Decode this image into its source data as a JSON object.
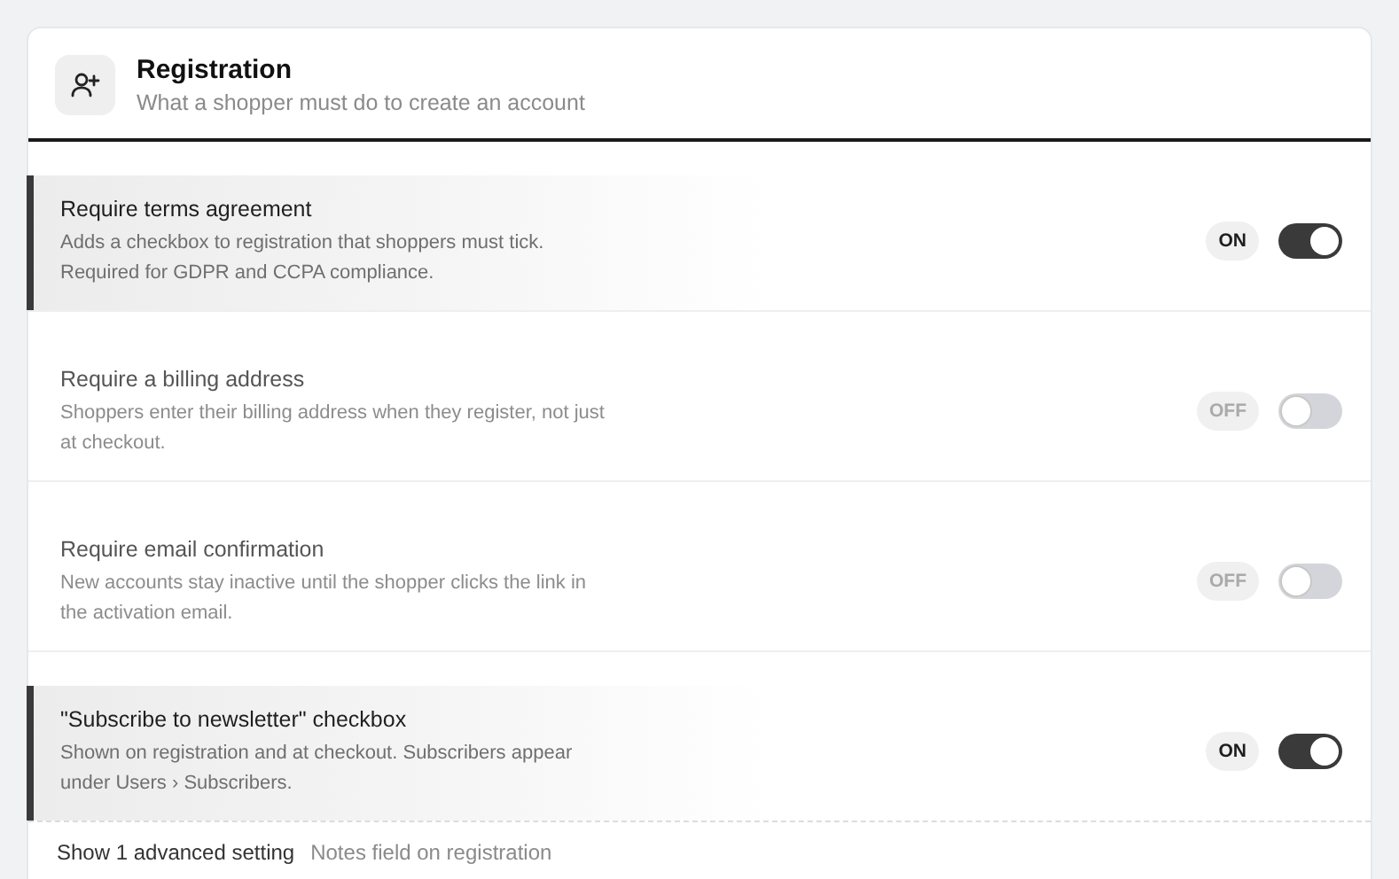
{
  "section": {
    "title": "Registration",
    "subtitle": "What a shopper must do to create an account"
  },
  "settings": [
    {
      "title": "Require terms agreement",
      "description": "Adds a checkbox to registration that shoppers must tick. Required for GDPR and CCPA compliance.",
      "badge": "ON",
      "on": true
    },
    {
      "title": "Require a billing address",
      "description": "Shoppers enter their billing address when they register, not just at checkout.",
      "badge": "OFF",
      "on": false
    },
    {
      "title": "Require email confirmation",
      "description": "New accounts stay inactive until the shopper clicks the link in the activation email.",
      "badge": "OFF",
      "on": false
    },
    {
      "title": "\"Subscribe to newsletter\" checkbox",
      "description": "Shown on registration and at checkout. Subscribers appear under Users › Subscribers.",
      "badge": "ON",
      "on": true
    }
  ],
  "footer": {
    "link": "Show 1 advanced setting",
    "hint": "Notes field on registration"
  }
}
